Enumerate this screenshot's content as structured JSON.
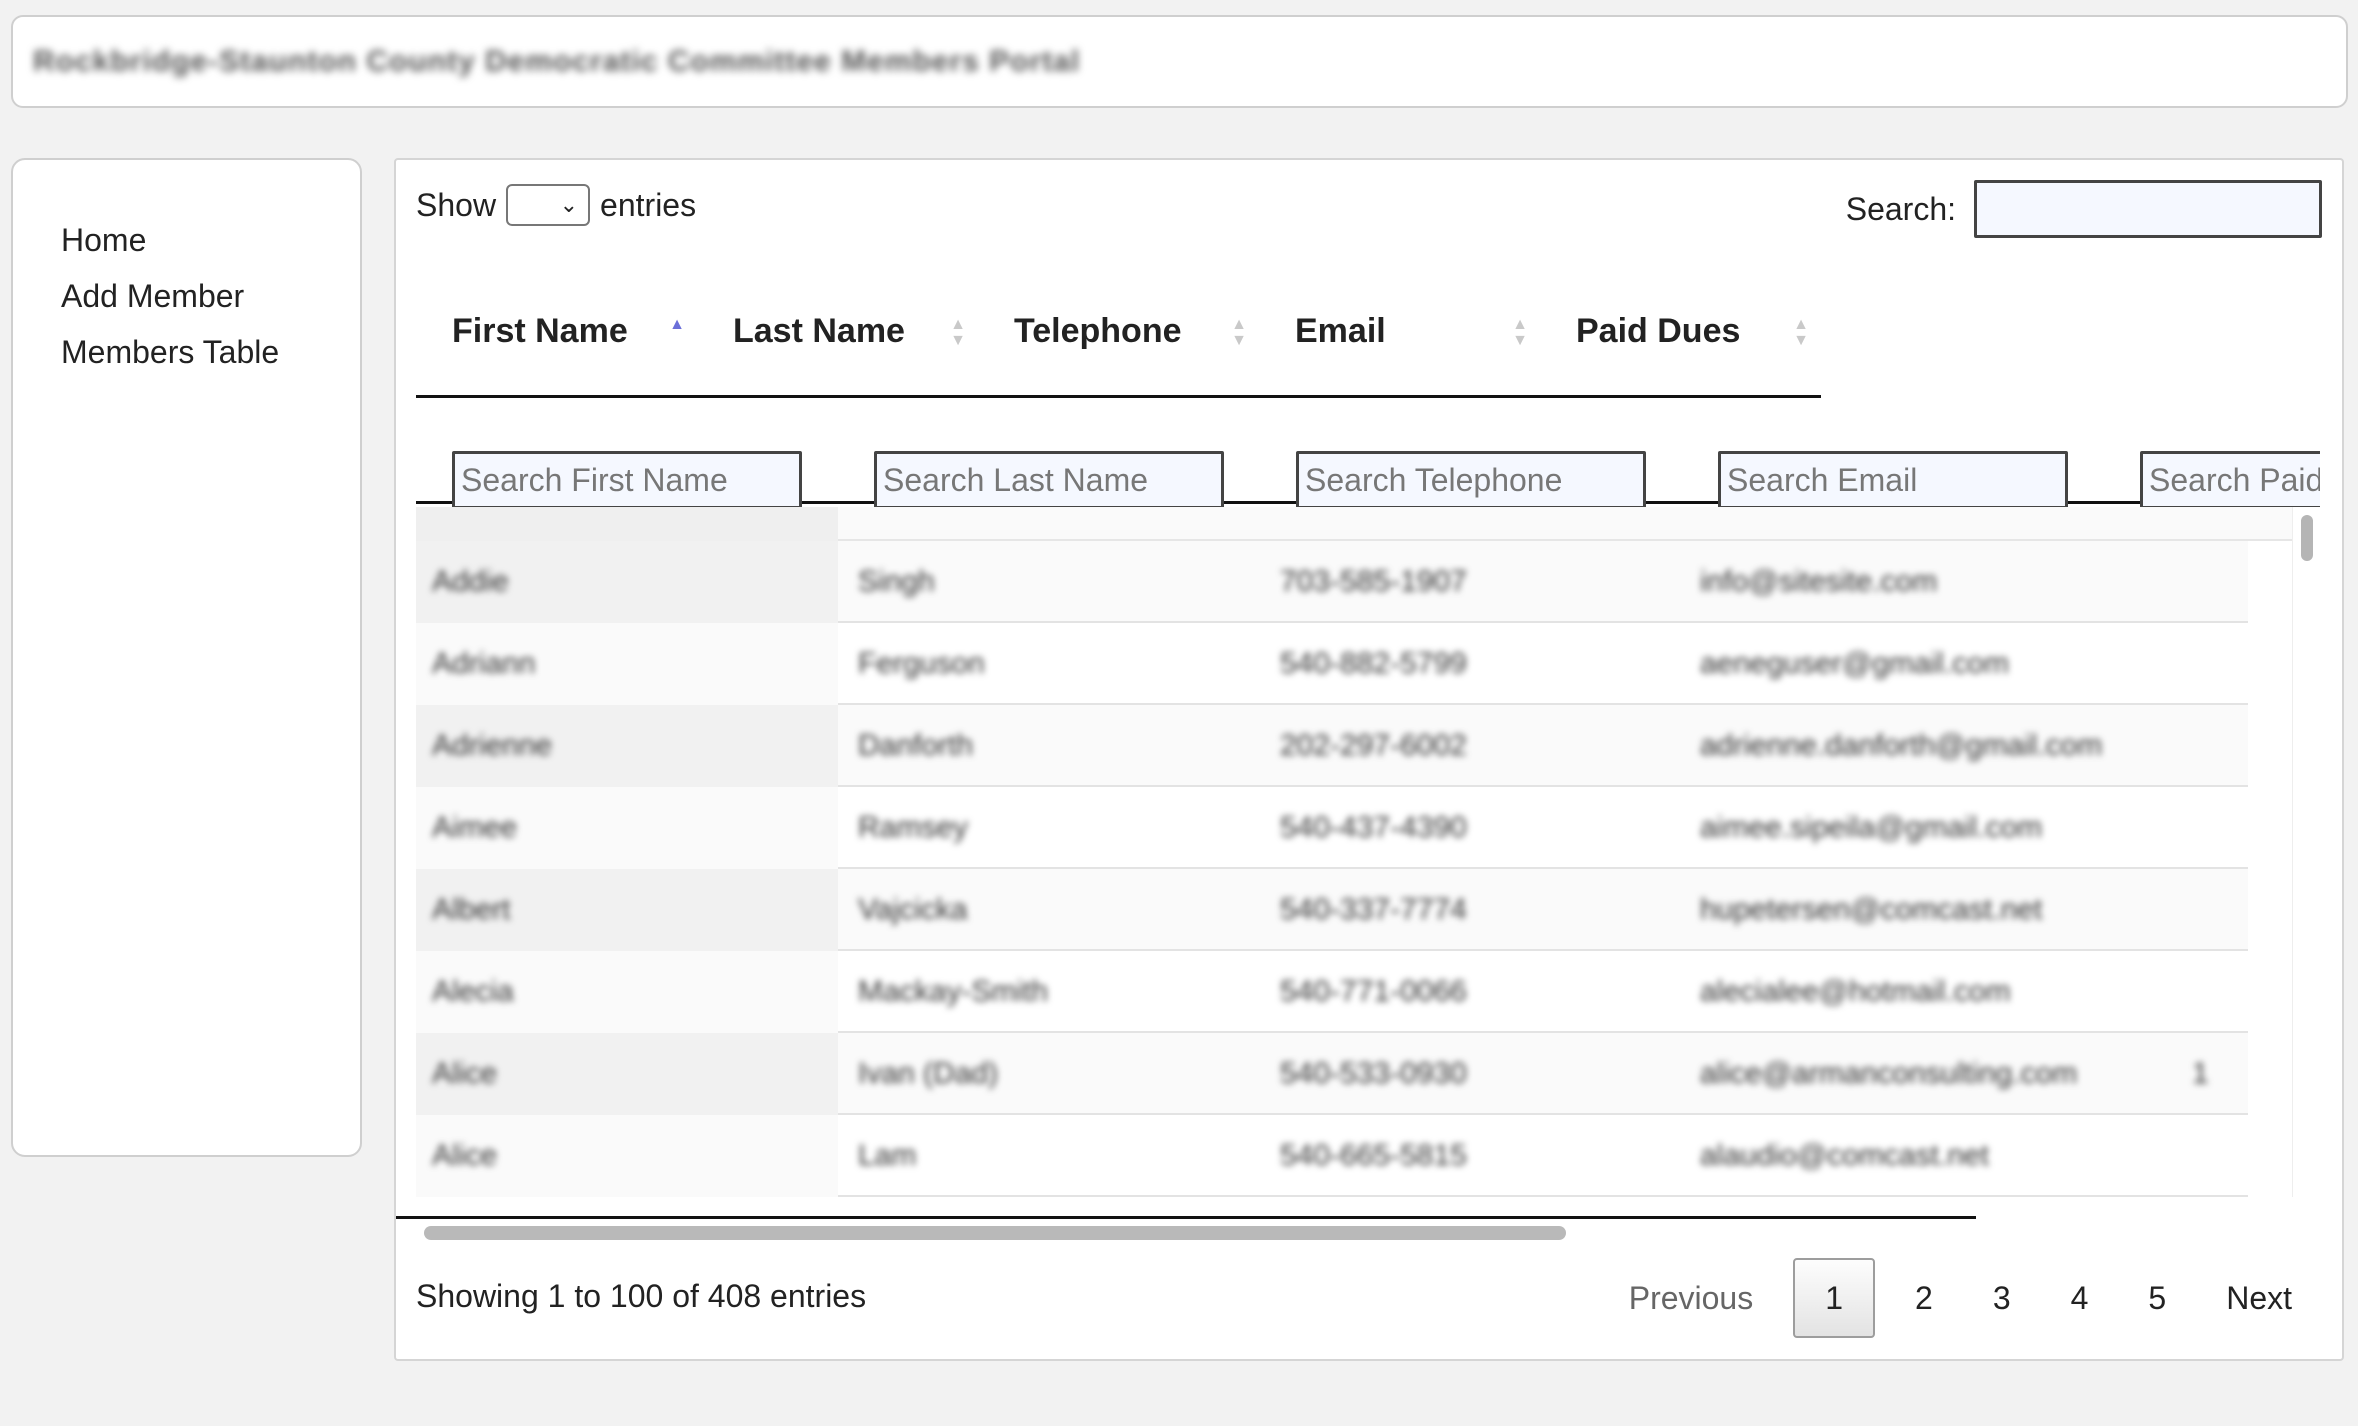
{
  "header": {
    "title": "Rockbridge-Staunton County Democratic Committee Members Portal"
  },
  "sidebar": {
    "items": [
      {
        "label": "Home"
      },
      {
        "label": "Add Member"
      },
      {
        "label": "Members Table"
      }
    ]
  },
  "controls": {
    "show_label": "Show",
    "entries_label": "entries",
    "search_label": "Search:",
    "length_value": ""
  },
  "columns": [
    {
      "label": "First Name",
      "placeholder": "Search First Name",
      "sorted": "asc"
    },
    {
      "label": "Last Name",
      "placeholder": "Search Last Name",
      "sorted": "none"
    },
    {
      "label": "Telephone",
      "placeholder": "Search Telephone",
      "sorted": "none"
    },
    {
      "label": "Email",
      "placeholder": "Search Email",
      "sorted": "none"
    },
    {
      "label": "Paid Dues",
      "placeholder": "Search Paid Dues",
      "sorted": "none"
    }
  ],
  "rows": [
    {
      "first": "Addie",
      "last": "Singh",
      "phone": "703-585-1907",
      "email": "info@sitesite.com",
      "dues": ""
    },
    {
      "first": "Adriann",
      "last": "Ferguson",
      "phone": "540-882-5799",
      "email": "aeneguser@gmail.com",
      "dues": ""
    },
    {
      "first": "Adrienne",
      "last": "Danforth",
      "phone": "202-297-6002",
      "email": "adrienne.danforth@gmail.com",
      "dues": ""
    },
    {
      "first": "Aimee",
      "last": "Ramsey",
      "phone": "540-437-4390",
      "email": "aimee.sipeila@gmail.com",
      "dues": ""
    },
    {
      "first": "Albert",
      "last": "Vajcicka",
      "phone": "540-337-7774",
      "email": "hupetersen@comcast.net",
      "dues": ""
    },
    {
      "first": "Alecia",
      "last": "Mackay-Smith",
      "phone": "540-771-0066",
      "email": "alecialee@hotmail.com",
      "dues": ""
    },
    {
      "first": "Alice",
      "last": "Ivan (Dad)",
      "phone": "540-533-0930",
      "email": "alice@armanconsulting.com",
      "dues": "1"
    },
    {
      "first": "Alice",
      "last": "Lam",
      "phone": "540-665-5815",
      "email": "alaudio@comcast.net",
      "dues": ""
    }
  ],
  "footer": {
    "info": "Showing 1 to 100 of 408 entries",
    "previous": "Previous",
    "next": "Next",
    "pages": [
      "1",
      "2",
      "3",
      "4",
      "5"
    ],
    "current_page": "1"
  }
}
